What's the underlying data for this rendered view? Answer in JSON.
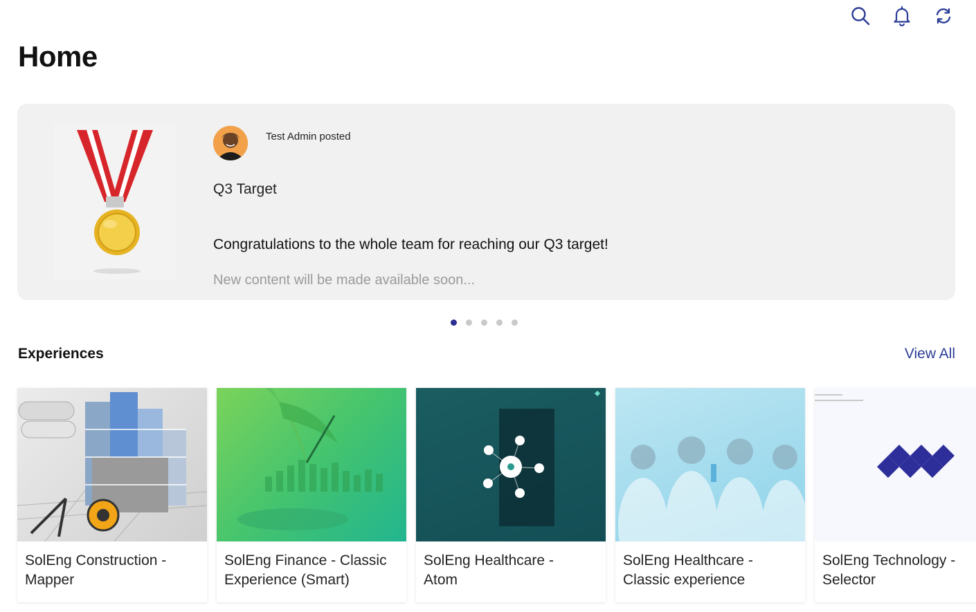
{
  "header": {
    "title": "Home",
    "icons": [
      "search-icon",
      "bell-icon",
      "refresh-icon"
    ]
  },
  "feed": {
    "author_line": "Test Admin posted",
    "post_title": "Q3 Target",
    "post_body": "Congratulations to the whole team for reaching our Q3 target!",
    "teaser": "New content will be made available soon...",
    "slides_total": 5,
    "active_slide": 1
  },
  "experiences": {
    "section_title": "Experiences",
    "view_all_label": "View All",
    "cards": [
      {
        "line1": "SolEng Construction -",
        "line2": "Mapper"
      },
      {
        "line1": "SolEng Finance - Classic",
        "line2": "Experience (Smart)"
      },
      {
        "line1": "SolEng Healthcare -",
        "line2": "Atom"
      },
      {
        "line1": "SolEng Healthcare -",
        "line2": "Classic experience"
      },
      {
        "line1": "SolEng Technology -",
        "line2": "Selector"
      }
    ]
  },
  "colors": {
    "accent": "#2b3c96",
    "active_dot": "#2b2f8f",
    "medal_ribbon_red": "#d7262b",
    "medal_gold": "#e6b422"
  }
}
